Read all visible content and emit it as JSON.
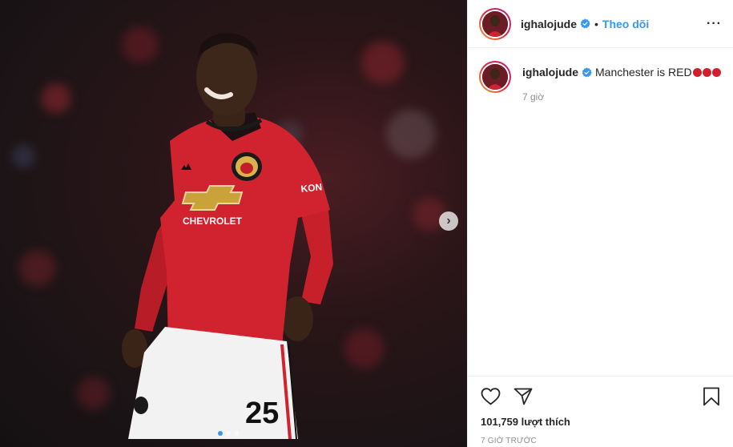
{
  "post": {
    "author": {
      "username": "ighalojude",
      "verified": true,
      "follow_label": "Theo dõi",
      "separator": "•"
    },
    "more_label": "···",
    "caption": {
      "username": "ighalojude",
      "text": "Manchester is RED",
      "emoji": [
        "red-circle",
        "red-circle",
        "red-circle"
      ],
      "time": "7 giờ"
    },
    "likes": "101,759 lượt thích",
    "date": "7 GIỜ TRƯỚC",
    "carousel": {
      "next_label": "›",
      "slides": 3,
      "active_slide": 1
    },
    "photo": {
      "sponsor": "CHEVROLET",
      "sleeve": "KON",
      "shorts_number": "25"
    }
  },
  "colors": {
    "link_blue": "#3897f0",
    "text": "#262626",
    "muted": "#8e8e8e",
    "border": "#efefef",
    "kit_red": "#d21f2e"
  }
}
